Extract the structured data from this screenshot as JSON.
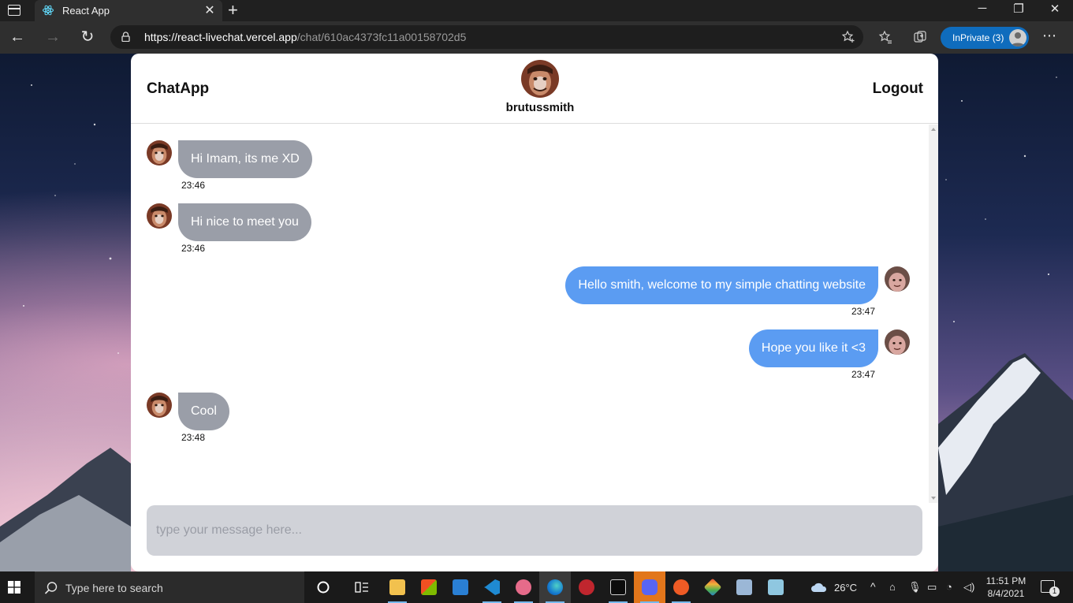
{
  "browser": {
    "tab_title": "React App",
    "url_host": "https://react-livechat.vercel.app",
    "url_path": "/chat/610ac4373fc11a00158702d5",
    "inprivate_label": "InPrivate (3)"
  },
  "chat": {
    "brand": "ChatApp",
    "logout": "Logout",
    "username": "brutussmith",
    "input_placeholder": "type your message here...",
    "messages": [
      {
        "direction": "in",
        "text": "Hi Imam, its me XD",
        "time": "23:46"
      },
      {
        "direction": "in",
        "text": "Hi nice to meet you",
        "time": "23:46"
      },
      {
        "direction": "out",
        "text": "Hello smith, welcome to my simple chatting website",
        "time": "23:47"
      },
      {
        "direction": "out",
        "text": "Hope you like it <3",
        "time": "23:47"
      },
      {
        "direction": "in",
        "text": "Cool",
        "time": "23:48"
      }
    ],
    "colors": {
      "incoming_bubble": "#9a9ea8",
      "outgoing_bubble": "#5b9cf2",
      "input_bg": "#d0d2d8"
    }
  },
  "taskbar": {
    "search_placeholder": "Type here to search",
    "temperature": "26°C",
    "time": "11:51 PM",
    "date": "8/4/2021",
    "notification_count": "1"
  }
}
